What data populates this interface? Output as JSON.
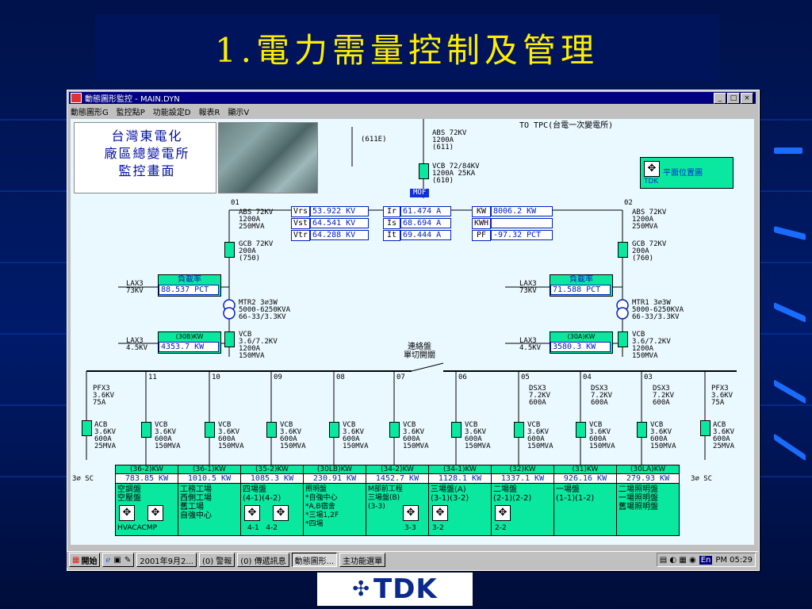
{
  "slide": {
    "title": "1.電力需量控制及管理",
    "logo": "TDK"
  },
  "window": {
    "title": "動態圖形監控 - MAIN.DYN",
    "menu": [
      "動態圖形G",
      "監控點P",
      "功能設定D",
      "報表R",
      "顯示V"
    ],
    "buttons": [
      "_",
      "□",
      "×"
    ]
  },
  "header": {
    "company": [
      "台灣東電化",
      "廠區總變電所",
      "監控畫面"
    ],
    "to_tpc": "TO TPC(台電一次變電所)",
    "layout_button": "平面位置圖",
    "layout_tag": "TDK",
    "mof": "MOF"
  },
  "incoming": {
    "sw611e": "(611E)",
    "abs_top": "ABS 72KV\n1200A\n(611)",
    "vcb_top": "VCB 72/84KV\n1200A 25KA\n(610)"
  },
  "measurements": {
    "labels": [
      "Vrs",
      "Vst",
      "Vtr"
    ],
    "values": [
      "53.922 KV",
      "64.541 KV",
      "64.288 KV"
    ],
    "ilabels": [
      "Ir",
      "Is",
      "It"
    ],
    "ivalues": [
      "61.474 A",
      "68.694 A",
      "69.444 A"
    ],
    "plabels": [
      "KW",
      "KWH",
      "PF"
    ],
    "pvalues": [
      "8006.2 KW",
      "",
      "-97.32 PCT"
    ]
  },
  "left_branch": {
    "num": "01",
    "abs": "ABS 72KV\n1200A\n250MVA",
    "gcb": "GCB 72KV\n200A\n(750)",
    "lax_top": "LAX3\n73KV",
    "load_label": "負載率",
    "load_value": "88.537 PCT",
    "mtr": "MTR2 3∅3W\n5000-6250KVA\n66-33/3.3KV",
    "lax_bot": "LAX3\n4.5KV",
    "kw_label": "(30B)KW",
    "kw_value": "4353.7 KW",
    "vcb": "VCB\n3.6/7.2KV\n1200A\n150MVA"
  },
  "right_branch": {
    "num": "02",
    "abs": "ABS 72KV\n1200A\n250MVA",
    "gcb": "GCB 72KV\n200A\n(760)",
    "lax_top": "LAX3\n73KV",
    "load_label": "負載率",
    "load_value": "71.588 PCT",
    "mtr": "MTR1 3∅3W\n5000-6250KVA\n66-33/3.3KV",
    "lax_bot": "LAX3\n4.5KV",
    "kw_label": "(30A)KW",
    "kw_value": "3580.3 KW",
    "vcb": "VCB\n3.6/7.2KV\n1200A\n150MVA"
  },
  "tie": "連絡盤\n單切開關",
  "bus_numbers": [
    "11",
    "10",
    "09",
    "08",
    "07",
    "06",
    "05",
    "04",
    "03"
  ],
  "side_feeders": {
    "left": {
      "pfx": "PFX3\n3.6KV\n75A",
      "acb": "ACB\n3.6KV\n600A\n25MVA",
      "sc": "3∅ SC"
    },
    "right": {
      "pfx": "PFX3\n3.6KV\n75A",
      "acb": "ACB\n3.6KV\n600A\n25MVA",
      "sc": "3∅ SC"
    }
  },
  "dsx": [
    "DSX3\n7.2KV\n600A",
    "DSX3\n7.2KV\n600A",
    "DSX3\n7.2KV\n600A"
  ],
  "vcb_feeder": "VCB\n3.6KV\n600A\n150MVA",
  "feeders": [
    {
      "head": "(36-2)KW",
      "value": "783.85 KW",
      "text": "空調盤\n空壓盤",
      "sub": "HVACACMP"
    },
    {
      "head": "(36-1)KW",
      "value": "1010.5 KW",
      "text": "工務工場\n西側工場\n舊工場\n自強中心",
      "sub": ""
    },
    {
      "head": "(35-2)KW",
      "value": "1085.3 KW",
      "text": "四場盤\n(4-1)(4-2)",
      "sub": "4-1   4-2"
    },
    {
      "head": "(30LB)KW",
      "value": "230.91 KW",
      "text": "照明盤\n*自強中心\n*A,B宿舍\n*三場1,2F\n*四場",
      "sub": ""
    },
    {
      "head": "(34-2)KW",
      "value": "1452.7 KW",
      "text": "M部前工程\n三場盤(B)\n(3-3)",
      "sub": "3-3"
    },
    {
      "head": "(34-1)KW",
      "value": "1128.1 KW",
      "text": "三場盤(A)\n(3-1)(3-2)",
      "sub": "3-2"
    },
    {
      "head": "(32)KW",
      "value": "1337.1 KW",
      "text": "二場盤\n(2-1)(2-2)",
      "sub": "2-2"
    },
    {
      "head": "(31)KW",
      "value": "926.16 KW",
      "text": "一場盤\n(1-1)(1-2)",
      "sub": ""
    },
    {
      "head": "(30LA)KW",
      "value": "279.93 KW",
      "text": "二場照明盤\n一場照明盤\n舊場照明盤",
      "sub": ""
    }
  ],
  "taskbar": {
    "start": "開始",
    "items": [
      "2001年9月2...",
      "(0) 警報",
      "(0) 傳遞訊息",
      "動態圖形...",
      "主功能選單"
    ],
    "tray": "En",
    "clock": "PM 05:29"
  }
}
